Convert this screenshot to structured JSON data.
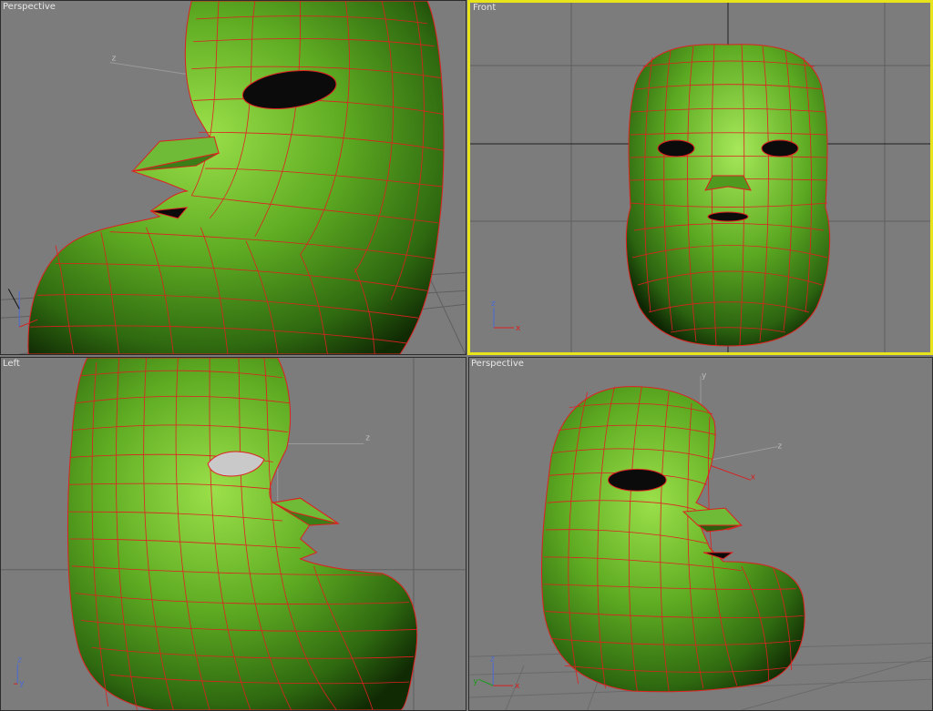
{
  "viewports": [
    {
      "label": "Perspective",
      "active": false
    },
    {
      "label": "Front",
      "active": true
    },
    {
      "label": "Left",
      "active": false
    },
    {
      "label": "Perspective",
      "active": false
    }
  ],
  "axis_labels": {
    "x": "x",
    "y": "y",
    "z": "z"
  },
  "colors": {
    "viewport_bg": "#7c7c7c",
    "active_border": "#e8e41c",
    "mesh_fill": "#5aa82c",
    "wire": "#e02020",
    "grid": "#5c5c5c"
  }
}
